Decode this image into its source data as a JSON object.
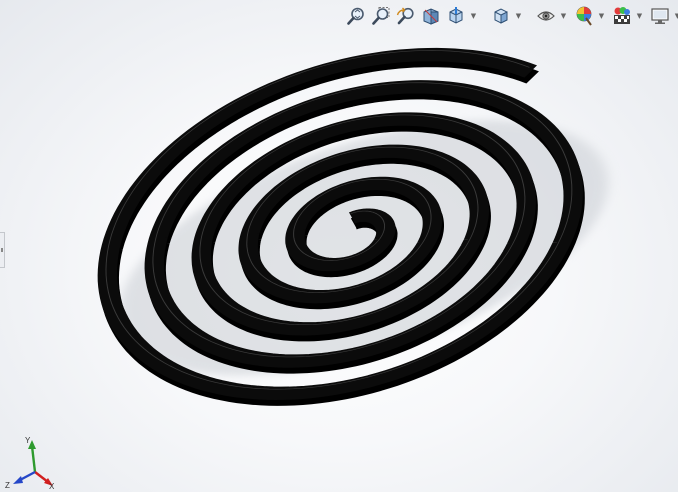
{
  "viewport": {
    "background_top": "#ffffff",
    "background_bottom": "#e6e9ee"
  },
  "toolbar": {
    "buttons": [
      {
        "icon": "zoom-to-fit-icon"
      },
      {
        "icon": "zoom-to-area-icon"
      },
      {
        "icon": "previous-view-icon"
      },
      {
        "icon": "section-view-icon"
      },
      {
        "icon": "view-orientation-icon",
        "has_dropdown": true
      },
      {
        "icon": "display-style-icon",
        "has_dropdown": true
      },
      {
        "icon": "hide-show-items-icon",
        "has_dropdown": true
      },
      {
        "icon": "edit-appearance-icon",
        "has_dropdown": true
      },
      {
        "icon": "apply-scene-icon",
        "has_dropdown": true
      },
      {
        "icon": "view-settings-icon",
        "has_dropdown": true
      }
    ]
  },
  "model": {
    "shape": "flat-spiral-spring",
    "turns": 5,
    "color": "#0b0b0b",
    "highlight": "#3a3a3a"
  },
  "triad": {
    "x_label": "X",
    "y_label": "Y",
    "z_label": "Z",
    "x_color": "#d21f1f",
    "y_color": "#2e9a2e",
    "z_color": "#2547c8"
  }
}
